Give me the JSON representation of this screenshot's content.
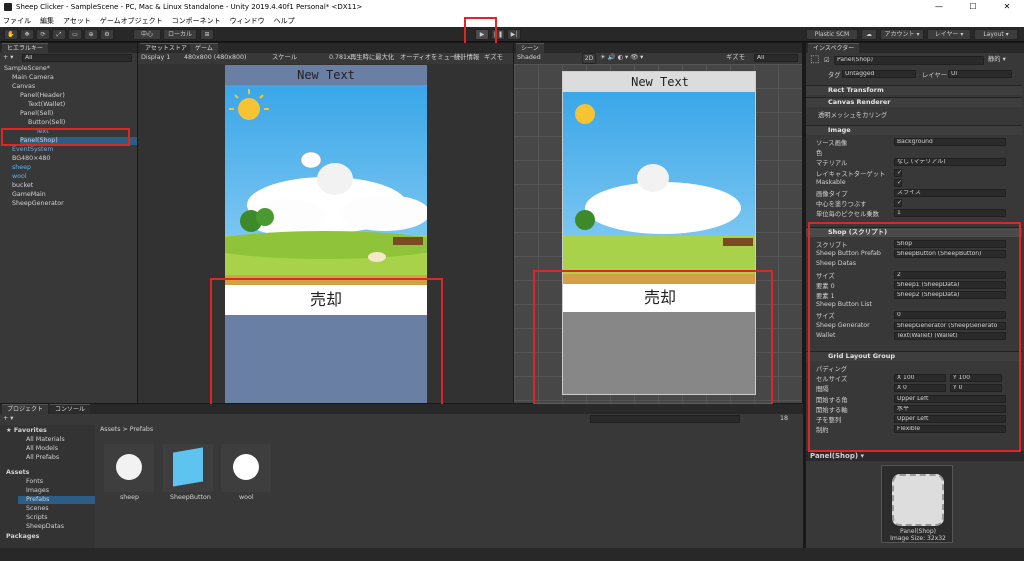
{
  "window": {
    "title": "Sheep Clicker - SampleScene - PC, Mac & Linux Standalone - Unity 2019.4.40f1 Personal* <DX11>"
  },
  "menu": [
    "ファイル",
    "編集",
    "アセット",
    "ゲームオブジェクト",
    "コンポーネント",
    "ウィンドウ",
    "ヘルプ"
  ],
  "toolbar": {
    "pivot": "中心",
    "space": "ローカル",
    "plastic": "Plastic SCM",
    "account": "アカウント ▾",
    "layers": "レイヤー ▾",
    "layout": "Layout ▾"
  },
  "hierarchy": {
    "tab": "ヒエラルキー",
    "search": "All",
    "items": [
      {
        "label": "SampleScene*",
        "depth": 0
      },
      {
        "label": "Main Camera",
        "depth": 1
      },
      {
        "label": "Canvas",
        "depth": 1
      },
      {
        "label": "Panel(Header)",
        "depth": 2
      },
      {
        "label": "Text(Wallet)",
        "depth": 3
      },
      {
        "label": "Panel(Sell)",
        "depth": 2
      },
      {
        "label": "Button(Sell)",
        "depth": 3
      },
      {
        "label": "Text",
        "depth": 4
      },
      {
        "label": "Panel(Shop)",
        "depth": 2
      },
      {
        "label": "EventSystem",
        "depth": 1
      },
      {
        "label": "BG480×480",
        "depth": 1
      },
      {
        "label": "sheep",
        "depth": 1
      },
      {
        "label": "wool",
        "depth": 1
      },
      {
        "label": "bucket",
        "depth": 1
      },
      {
        "label": "GameMain",
        "depth": 1
      },
      {
        "label": "SheepGenerator",
        "depth": 1
      }
    ]
  },
  "game": {
    "tabs": [
      "アセットストア",
      "ゲーム"
    ],
    "display": "Display 1",
    "resolution": "480x800 (480x800)",
    "scale_label": "スケール",
    "scale_value": "0.781x",
    "maximize": "再生時に最大化",
    "mute": "オーディオをミュート",
    "stats": "統計情報",
    "gizmos": "ギズモ",
    "header_text": "New Text",
    "sell_text": "売却"
  },
  "scene": {
    "tab": "シーン",
    "shading": "Shaded",
    "mode2d": "2D",
    "gizmos": "ギズモ",
    "search": "All",
    "header_text": "New Text",
    "sell_text": "売却"
  },
  "inspector": {
    "tab": "インスペクター",
    "name": "Panel(Shop)",
    "static": "静的 ▾",
    "tag_label": "タグ",
    "tag": "Untagged",
    "layer_label": "レイヤー",
    "layer": "UI",
    "components": {
      "rect": "Rect Transform",
      "canvas_renderer": "Canvas Renderer",
      "transparent": "透明メッシュをカリング",
      "image": "Image",
      "shop": "Shop (スクリプト)",
      "grid": "Grid Layout Group"
    },
    "image_fields": [
      [
        "ソース画像",
        "Background"
      ],
      [
        "色",
        ""
      ],
      [
        "マテリアル",
        "なし (マテリアル)"
      ],
      [
        "レイキャストターゲット",
        "✓"
      ],
      [
        "Maskable",
        "✓"
      ],
      [
        "画像タイプ",
        "スライス"
      ],
      [
        "中心を塗りつぶす",
        "✓"
      ],
      [
        "単位毎のピクセル乗数",
        "1"
      ]
    ],
    "shop_fields": [
      [
        "スクリプト",
        "Shop"
      ],
      [
        "Sheep Button Prefab",
        "SheepButton (SheepButton)"
      ],
      [
        "Sheep Datas",
        ""
      ],
      [
        "サイズ",
        "2"
      ],
      [
        "要素 0",
        "Sheep1 (SheepData)"
      ],
      [
        "要素 1",
        "Sheep2 (SheepData)"
      ],
      [
        "Sheep Button List",
        ""
      ],
      [
        "サイズ",
        "0"
      ],
      [
        "Sheep Generator",
        "SheepGenerator (SheepGenerato"
      ],
      [
        "Wallet",
        "Text(Wallet) (Wallet)"
      ]
    ],
    "grid_fields": [
      [
        "パディング",
        ""
      ],
      [
        "セルサイズ",
        "X 100",
        "Y 100"
      ],
      [
        "間隔",
        "X 0",
        "Y 0"
      ],
      [
        "開始する角",
        "Upper Left"
      ],
      [
        "開始する軸",
        "水平"
      ],
      [
        "子を整列",
        "Upper Left"
      ],
      [
        "制約",
        "Flexible"
      ]
    ],
    "preview_label": "Panel(Shop) ▾",
    "preview_name": "Panel(Shop)",
    "preview_size": "Image Size: 32x32"
  },
  "project": {
    "tabs": [
      "プロジェクト",
      "コンソール"
    ],
    "favorites": "Favorites",
    "fav_items": [
      "All Materials",
      "All Models",
      "All Prefabs"
    ],
    "assets": "Assets",
    "asset_folders": [
      "Fonts",
      "Images",
      "Prefabs",
      "Scenes",
      "Scripts",
      "SheepDatas"
    ],
    "packages": "Packages",
    "breadcrumb": "Assets > Prefabs",
    "prefabs": [
      "sheep",
      "SheepButton",
      "wool"
    ],
    "count": "18"
  },
  "colors": {
    "accent": "#2c5d87",
    "red": "#e02525",
    "sky": "#4fb4ec"
  }
}
